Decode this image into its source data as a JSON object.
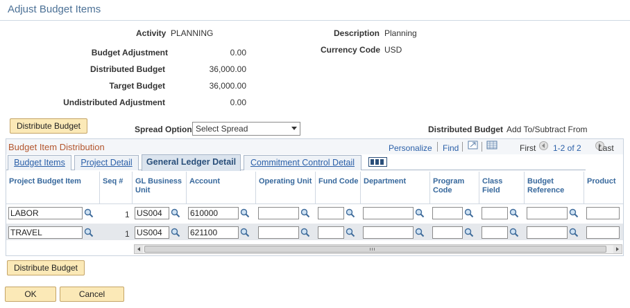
{
  "page": {
    "title": "Adjust Budget Items"
  },
  "header": {
    "activity_label": "Activity",
    "activity_value": "PLANNING",
    "description_label": "Description",
    "description_value": "Planning",
    "currency_label": "Currency Code",
    "currency_value": "USD",
    "budget_adjustment_label": "Budget Adjustment",
    "budget_adjustment_value": "0.00",
    "distributed_budget_label": "Distributed Budget",
    "distributed_budget_value": "36,000.00",
    "target_budget_label": "Target Budget",
    "target_budget_value": "36,000.00",
    "undistributed_label": "Undistributed Adjustment",
    "undistributed_value": "0.00"
  },
  "controls": {
    "distribute_button_label": "Distribute Budget",
    "spread_option_label": "Spread Option",
    "spread_option_value": "Select Spread",
    "dist_budget_label": "Distributed Budget",
    "dist_budget_value": "Add To/Subtract From"
  },
  "grid": {
    "title": "Budget Item Distribution",
    "personalize": "Personalize",
    "find": "Find",
    "first": "First",
    "range": "1-2 of 2",
    "last": "Last",
    "tabs": [
      "Budget Items",
      "Project Detail",
      "General Ledger Detail",
      "Commitment Control Detail"
    ],
    "active_tab": "General Ledger Detail",
    "columns": [
      "Project Budget Item",
      "Seq #",
      "GL Business Unit",
      "Account",
      "Operating Unit",
      "Fund Code",
      "Department",
      "Program Code",
      "Class Field",
      "Budget Reference",
      "Product"
    ],
    "rows": [
      {
        "item": "LABOR",
        "seq": "1",
        "bu": "US004",
        "account": "610000"
      },
      {
        "item": "TRAVEL",
        "seq": "1",
        "bu": "US004",
        "account": "621100"
      }
    ]
  },
  "footer": {
    "distribute_button_label": "Distribute Budget",
    "ok_label": "OK",
    "cancel_label": "Cancel"
  },
  "colors": {
    "accent": "#4c7196",
    "button": "#fbe9b7",
    "grid_title": "#b3562e",
    "link": "#2a5fa8"
  }
}
